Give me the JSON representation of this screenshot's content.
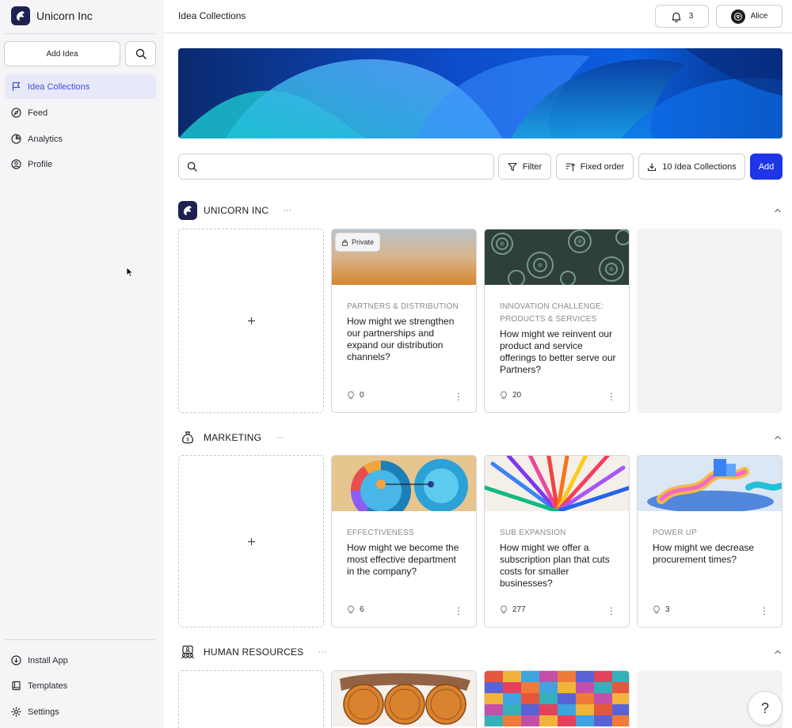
{
  "sidebar": {
    "brand": "Unicorn Inc",
    "add_idea": "Add Idea",
    "nav": [
      {
        "label": "Idea Collections",
        "icon": "flag-icon",
        "active": true
      },
      {
        "label": "Feed",
        "icon": "compass-icon"
      },
      {
        "label": "Analytics",
        "icon": "pie-chart-icon"
      },
      {
        "label": "Profile",
        "icon": "user-circle-icon"
      }
    ],
    "bottom": [
      {
        "label": "Install App",
        "icon": "download-circle-icon"
      },
      {
        "label": "Templates",
        "icon": "book-icon"
      },
      {
        "label": "Settings",
        "icon": "gear-icon"
      }
    ]
  },
  "header": {
    "title": "Idea Collections",
    "notifications": "3",
    "user": "Alice"
  },
  "toolbar": {
    "search_placeholder": "",
    "filter": "Filter",
    "order": "Fixed order",
    "count": "10 Idea Collections",
    "add": "Add"
  },
  "sections": [
    {
      "title": "UNICORN INC",
      "more": "···",
      "cards": [
        {
          "category": "PARTNERS & DISTRIBUTION",
          "question": "How might we strengthen our partnerships and expand our distribution channels?",
          "count": "0",
          "badge": "Private"
        },
        {
          "category": "INNOVATION CHALLENGE: PRODUCTS & SERVICES",
          "question": "How might we reinvent our product and service offerings to better serve our Partners?",
          "count": "20"
        }
      ]
    },
    {
      "title": "MARKETING",
      "more": "···",
      "cards": [
        {
          "category": "EFFECTIVENESS",
          "question": "How might we become the most effective department in the company?",
          "count": "6"
        },
        {
          "category": "SUB EXPANSION",
          "question": "How might we offer a subscription plan that cuts costs for smaller businesses?",
          "count": "277"
        },
        {
          "category": "POWER UP",
          "question": "How might we decrease procurement times?",
          "count": "3"
        }
      ]
    },
    {
      "title": "HUMAN RESOURCES",
      "more": "···"
    }
  ],
  "help": "?",
  "colors": {
    "accent": "#1f35e8",
    "active_nav_bg": "#e7e9f8",
    "active_nav_text": "#3f4fd1"
  }
}
